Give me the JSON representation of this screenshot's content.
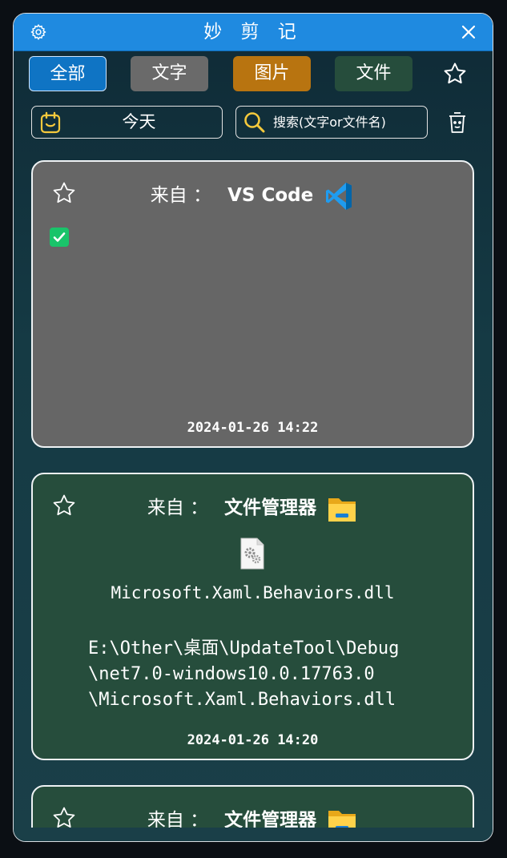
{
  "window": {
    "title": "妙 剪 记"
  },
  "filters": {
    "all": "全部",
    "text": "文字",
    "image": "图片",
    "file": "文件"
  },
  "toolbar": {
    "date_label": "今天",
    "search_placeholder": "搜索(文字or文件名)"
  },
  "cards": [
    {
      "from_label": "来自 ：",
      "app": "VS Code",
      "app_icon": "vscode-icon",
      "content_type": "checkbox",
      "time": "2024-01-26 14:22"
    },
    {
      "from_label": "来自 ：",
      "app": "文件管理器",
      "app_icon": "file-explorer-icon",
      "file_name": "Microsoft.Xaml.Behaviors.dll",
      "file_path": "E:\\Other\\桌面\\UpdateTool\\Debug\n\\net7.0-windows10.0.17763.0\n\\Microsoft.Xaml.Behaviors.dll",
      "time": "2024-01-26 14:20"
    },
    {
      "from_label": "来自 ：",
      "app": "文件管理器",
      "app_icon": "file-explorer-icon"
    }
  ],
  "colors": {
    "titlebar": "#1f8ae0",
    "filter_all": "#0f74c4",
    "filter_text": "#6a6a6a",
    "filter_image": "#b87410",
    "filter_file": "#264d3c",
    "card_text": "#666666",
    "card_file": "#264d3c",
    "accent_yellow": "#f5c93c"
  }
}
